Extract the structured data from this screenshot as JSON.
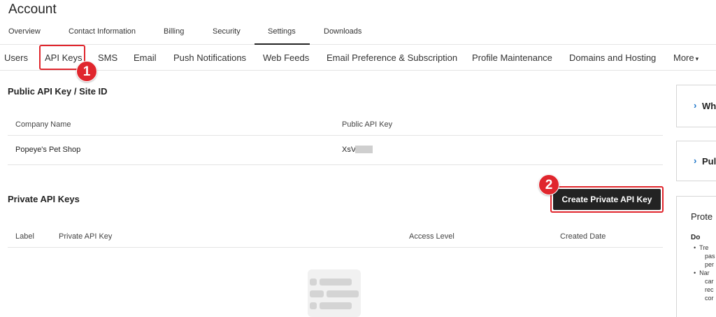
{
  "page": {
    "title": "Account"
  },
  "top_tabs": [
    {
      "label": "Overview"
    },
    {
      "label": "Contact Information"
    },
    {
      "label": "Billing"
    },
    {
      "label": "Security"
    },
    {
      "label": "Settings"
    },
    {
      "label": "Downloads"
    }
  ],
  "sub_tabs": [
    {
      "label": "Users"
    },
    {
      "label": "API Keys"
    },
    {
      "label": "SMS"
    },
    {
      "label": "Email"
    },
    {
      "label": "Push Notifications"
    },
    {
      "label": "Web Feeds"
    },
    {
      "label": "Email Preference & Subscription"
    },
    {
      "label": "Profile Maintenance"
    },
    {
      "label": "Domains and Hosting"
    },
    {
      "label": "More"
    }
  ],
  "annotations": {
    "badge1": "1",
    "badge2": "2",
    "accent_color": "#e0262d"
  },
  "public_section": {
    "title": "Public API Key / Site ID",
    "headers": {
      "company": "Company Name",
      "key": "Public API Key"
    },
    "row": {
      "company": "Popeye's Pet Shop",
      "key": "XsV"
    }
  },
  "private_section": {
    "title": "Private API Keys",
    "create_button": "Create Private API Key",
    "headers": {
      "label": "Label",
      "key": "Private API Key",
      "access": "Access Level",
      "created": "Created Date"
    }
  },
  "side": {
    "panel1": "Wh",
    "panel2": "Pul",
    "panel3_heading": "Prote",
    "panel3_do": "Do",
    "panel3_lines": [
      "Tre",
      "pas",
      "per",
      "Nar",
      "car",
      "rec",
      "cor"
    ]
  }
}
